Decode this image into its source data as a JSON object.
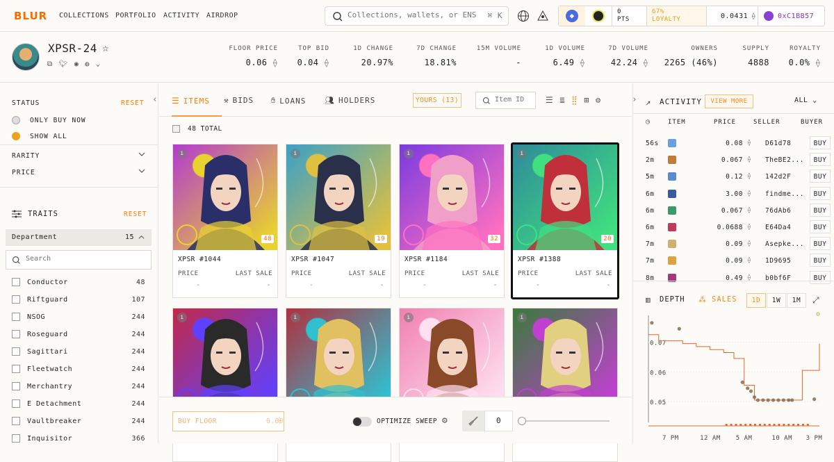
{
  "nav": {
    "logo": "BLUR",
    "links": [
      "COLLECTIONS",
      "PORTFOLIO",
      "ACTIVITY",
      "AIRDROP"
    ],
    "search_placeholder": "Collections, wallets, or ENS",
    "search_shortcut": "⌘ K",
    "pts_value": "0",
    "pts_label": "PTS",
    "loyalty_pct": "67%",
    "loyalty_label": "LOYALTY",
    "balance": "0.0431",
    "wallet": "0xC1BB57"
  },
  "collection": {
    "name": "XPSR-24",
    "stats": [
      {
        "label": "FLOOR PRICE",
        "value": "0.06",
        "eth": true
      },
      {
        "label": "TOP BID",
        "value": "0.04",
        "eth": true
      },
      {
        "label": "1D CHANGE",
        "value": "20.97%",
        "positive": true
      },
      {
        "label": "7D CHANGE",
        "value": "18.81%",
        "positive": true
      },
      {
        "label": "15M VOLUME",
        "value": "-"
      },
      {
        "label": "1D VOLUME",
        "value": "6.49",
        "eth": true
      },
      {
        "label": "7D VOLUME",
        "value": "42.24",
        "eth": true
      },
      {
        "label": "OWNERS",
        "value": "2265 (46%)"
      },
      {
        "label": "SUPPLY",
        "value": "4888"
      },
      {
        "label": "ROYALTY",
        "value": "0.0%",
        "eth": true
      }
    ]
  },
  "sidebar": {
    "status_label": "STATUS",
    "reset": "RESET",
    "only_buy_now": "ONLY BUY NOW",
    "show_all": "SHOW ALL",
    "rarity": "RARITY",
    "price": "PRICE",
    "traits_label": "TRAITS",
    "department_label": "Department",
    "department_count": "15",
    "search_placeholder": "Search",
    "traits": [
      {
        "name": "Conductor",
        "count": "48"
      },
      {
        "name": "Riftguard",
        "count": "107"
      },
      {
        "name": "NSOG",
        "count": "244"
      },
      {
        "name": "Roseguard",
        "count": "244"
      },
      {
        "name": "Sagittari",
        "count": "244"
      },
      {
        "name": "Fleetwatch",
        "count": "244"
      },
      {
        "name": "Merchantry",
        "count": "244"
      },
      {
        "name": "E Detachment",
        "count": "244"
      },
      {
        "name": "Vaultbreaker",
        "count": "244"
      },
      {
        "name": "Inquisitor",
        "count": "366"
      }
    ]
  },
  "main": {
    "tabs": [
      "ITEMS",
      "BIDS",
      "LOANS",
      "HOLDERS"
    ],
    "yours": "YOURS (13)",
    "item_id_placeholder": "Item ID",
    "total": "48 TOTAL",
    "price_label": "PRICE",
    "last_sale_label": "LAST SALE",
    "dash": "-",
    "cards": [
      {
        "name": "XPSR #1044",
        "rank": "48",
        "bg": "#b43ad0",
        "accent": "#e8d230",
        "hair": "#2a2f6a"
      },
      {
        "name": "XPSR #1047",
        "rank": "19",
        "bg": "#3aa0c8",
        "accent": "#e0c040",
        "hair": "#2a2f4a"
      },
      {
        "name": "XPSR #1184",
        "rank": "32",
        "bg": "#7a3ae0",
        "accent": "#ff70c0",
        "hair": "#f0a0c8"
      },
      {
        "name": "XPSR #1388",
        "rank": "20",
        "bg": "#2f8a9a",
        "accent": "#40e080",
        "hair": "#c0303a"
      },
      {
        "name": "",
        "rank": "",
        "bg": "#c02a4a",
        "accent": "#6040ff",
        "hair": "#2a2a2a"
      },
      {
        "name": "",
        "rank": "",
        "bg": "#b03040",
        "accent": "#30c0d0",
        "hair": "#e0c060"
      },
      {
        "name": "",
        "rank": "",
        "bg": "#f080b0",
        "accent": "#ffe0f0",
        "hair": "#8a4a2a"
      },
      {
        "name": "",
        "rank": "",
        "bg": "#3a7a3a",
        "accent": "#c040d0",
        "hair": "#e0d080"
      }
    ],
    "buy_floor": "BUY FLOOR",
    "buy_floor_value": "0.00",
    "optimize_sweep": "OPTIMIZE SWEEP",
    "sweep_count": "0"
  },
  "activity": {
    "title": "ACTIVITY",
    "view_more": "VIEW MORE",
    "filter": "ALL",
    "headers": [
      "ITEM",
      "PRICE",
      "SELLER",
      "BUYER"
    ],
    "buy": "BUY",
    "rows": [
      {
        "ago": "56s",
        "price": "0.08",
        "seller": "D61d78",
        "color": "#6aa0e0"
      },
      {
        "ago": "2m",
        "price": "0.067",
        "seller": "TheBE2...",
        "color": "#c07a3a"
      },
      {
        "ago": "5m",
        "price": "0.12",
        "seller": "142d2F",
        "color": "#5a8ad0"
      },
      {
        "ago": "6m",
        "price": "3.00",
        "seller": "findme...",
        "color": "#3a5aa0"
      },
      {
        "ago": "6m",
        "price": "0.067",
        "seller": "76dAb6",
        "color": "#3a9a6a"
      },
      {
        "ago": "6m",
        "price": "0.0688",
        "seller": "E64Da4",
        "color": "#c03a5a"
      },
      {
        "ago": "7m",
        "price": "0.09",
        "seller": "Asepke...",
        "color": "#d0b070"
      },
      {
        "ago": "7m",
        "price": "0.09",
        "seller": "1D9695",
        "color": "#e0a040"
      },
      {
        "ago": "8m",
        "price": "0.49",
        "seller": "b0bf6F",
        "color": "#a03a7a"
      }
    ]
  },
  "chart_panel": {
    "depth": "DEPTH",
    "sales": "SALES",
    "ranges": [
      "1D",
      "1W",
      "1M"
    ],
    "active_range": "1D"
  },
  "chart_data": {
    "type": "line",
    "title": "",
    "x_ticks": [
      "7 PM",
      "12 AM",
      "5 AM",
      "10 AM",
      "3 PM"
    ],
    "y_ticks": [
      "0.07",
      "0.06",
      "0.05"
    ],
    "ylim": [
      0.043,
      0.079
    ],
    "floor_series": {
      "name": "",
      "x": [
        0,
        0.06,
        0.12,
        0.2,
        0.28,
        0.36,
        0.44,
        0.5,
        0.56,
        0.62,
        0.7,
        0.78,
        0.84,
        0.9,
        0.96,
        1.0
      ],
      "y": [
        0.0725,
        0.0705,
        0.0705,
        0.0695,
        0.0685,
        0.0675,
        0.0665,
        0.0645,
        0.0555,
        0.0505,
        0.0505,
        0.0505,
        0.0505,
        0.0605,
        0.0605,
        0.0695
      ]
    },
    "sales_points": [
      {
        "x": 0.02,
        "y": 0.0765
      },
      {
        "x": 0.18,
        "y": 0.0745
      },
      {
        "x": 0.55,
        "y": 0.0565
      },
      {
        "x": 0.58,
        "y": 0.0545
      },
      {
        "x": 0.6,
        "y": 0.0535
      },
      {
        "x": 0.62,
        "y": 0.0515
      },
      {
        "x": 0.64,
        "y": 0.0505
      },
      {
        "x": 0.67,
        "y": 0.0505
      },
      {
        "x": 0.7,
        "y": 0.0505
      },
      {
        "x": 0.73,
        "y": 0.0505
      },
      {
        "x": 0.76,
        "y": 0.0505
      },
      {
        "x": 0.79,
        "y": 0.0505
      },
      {
        "x": 0.82,
        "y": 0.0505
      },
      {
        "x": 0.84,
        "y": 0.0505
      },
      {
        "x": 0.97,
        "y": 0.0508
      }
    ],
    "colors": {
      "floor": "#e06a2a",
      "sales": "#8a6a50"
    }
  }
}
